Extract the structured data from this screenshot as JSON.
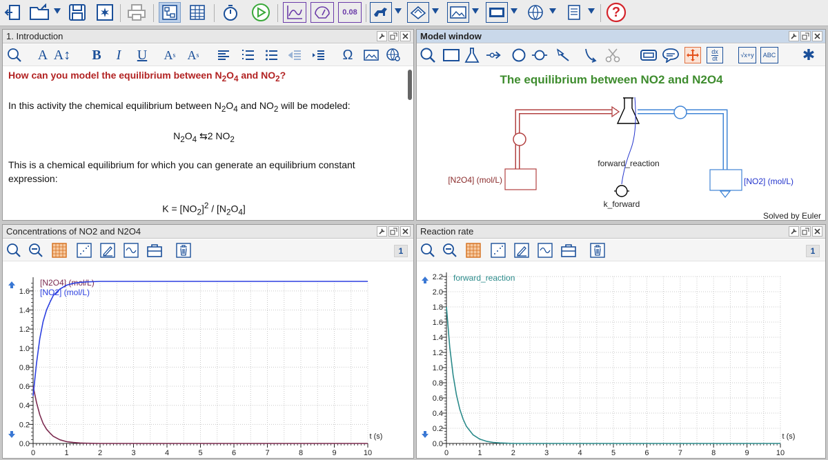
{
  "toolbar": {
    "result_label": "0.08",
    "help_label": "?"
  },
  "intro_panel": {
    "title": "1. Introduction",
    "toolbar_labels": {
      "font_a": "A",
      "bold": "B",
      "italic": "I",
      "underline": "U",
      "omega": "Ω"
    },
    "question_pre": "How can you model the equilibrium between N",
    "q_sub1": "2",
    "q_mid1": "O",
    "q_sub2": "4",
    "q_mid2": " and NO",
    "q_sub3": "2",
    "q_post": "?",
    "para1_pre": "In this activity the chemical equilibrium between N",
    "p1_sub1": "2",
    "p1_mid1": "O",
    "p1_sub2": "4",
    "p1_mid2": " and NO",
    "p1_sub3": "2",
    "p1_post": " will be modeled:",
    "eq_left": "N",
    "eq_sub1": "2",
    "eq_o": "O",
    "eq_sub2": "4",
    "eq_arrow": " ⇆",
    "eq_right": "2 NO",
    "eq_sub3": "2",
    "para2": "This is a chemical equilibrium for which you can generate an equilibrium constant expression:",
    "k_pre": "K = [NO",
    "k_sub1": "2",
    "k_mid": "]",
    "k_sup": "2",
    "k_mid2": " / [N",
    "k_sub2": "2",
    "k_o": "O",
    "k_sub3": "4",
    "k_post": "]"
  },
  "model_panel": {
    "title": "Model window",
    "heading": "The equilibrium between NO2 and N2O4",
    "flow_label": "forward_reaction",
    "stock_left": "[N2O4] (mol/L)",
    "stock_right": "[NO2] (mol/L)",
    "constant_label": "k_forward",
    "solver": "Solved by Euler",
    "tool_dxdt_top": "dx",
    "tool_dxdt_bottom": "dt",
    "tool_sqrt": "√x+y",
    "tool_abc": "ABC"
  },
  "graph1_panel": {
    "title": "Concentrations of NO2 and N2O4",
    "badge": "1"
  },
  "graph2_panel": {
    "title": "Reaction rate",
    "badge": "1"
  },
  "chart_data": [
    {
      "type": "line",
      "title": "Concentrations of NO2 and N2O4",
      "xlabel": "t (s)",
      "ylabel": "",
      "xlim": [
        0,
        10
      ],
      "ylim": [
        0,
        1.7
      ],
      "x_ticks": [
        0,
        1,
        2,
        3,
        4,
        5,
        6,
        7,
        8,
        9,
        10
      ],
      "y_ticks": [
        0.0,
        0.2,
        0.4,
        0.6,
        0.8,
        1.0,
        1.2,
        1.4,
        1.6
      ],
      "y_tick_labels": [
        "0.0",
        "0.2",
        "0.4",
        "0.6",
        "0.8",
        "1.0",
        "1.2",
        "1.4",
        "1.6"
      ],
      "grid": true,
      "legend_position": "top-left",
      "series": [
        {
          "name": "[N2O4] (mol/L)",
          "color": "#7b2a4f",
          "x": [
            0,
            0.1,
            0.2,
            0.3,
            0.4,
            0.5,
            0.6,
            0.8,
            1.0,
            1.2,
            1.4,
            1.6,
            2.0,
            3.0,
            10.0
          ],
          "y": [
            0.6,
            0.43,
            0.3,
            0.21,
            0.15,
            0.11,
            0.075,
            0.038,
            0.019,
            0.01,
            0.005,
            0.002,
            0.0,
            0.0,
            0.0
          ]
        },
        {
          "name": "[NO2] (mol/L)",
          "color": "#2b3fe0",
          "x": [
            0,
            0.1,
            0.2,
            0.3,
            0.4,
            0.5,
            0.6,
            0.8,
            1.0,
            1.2,
            1.4,
            1.6,
            2.0,
            3.0,
            10.0
          ],
          "y": [
            0.5,
            0.84,
            1.1,
            1.28,
            1.4,
            1.48,
            1.55,
            1.62,
            1.66,
            1.68,
            1.69,
            1.695,
            1.7,
            1.7,
            1.7
          ]
        }
      ]
    },
    {
      "type": "line",
      "title": "Reaction rate",
      "xlabel": "t (s)",
      "ylabel": "",
      "xlim": [
        0,
        10
      ],
      "ylim": [
        0,
        2.2
      ],
      "x_ticks": [
        0,
        1,
        2,
        3,
        4,
        5,
        6,
        7,
        8,
        9,
        10
      ],
      "y_ticks": [
        0.0,
        0.2,
        0.4,
        0.6,
        0.8,
        1.0,
        1.2,
        1.4,
        1.6,
        1.8,
        2.0,
        2.2
      ],
      "y_tick_labels": [
        "0.0",
        "0.2",
        "0.4",
        "0.6",
        "0.8",
        "1.0",
        "1.2",
        "1.4",
        "1.6",
        "1.8",
        "2.0",
        "2.2"
      ],
      "grid": true,
      "legend_position": "top-left",
      "series": [
        {
          "name": "forward_reaction",
          "color": "#2a8a8a",
          "x": [
            0,
            0.1,
            0.2,
            0.3,
            0.4,
            0.5,
            0.6,
            0.8,
            1.0,
            1.2,
            1.4,
            1.6,
            2.0,
            3.0,
            10.0
          ],
          "y": [
            1.8,
            1.27,
            0.9,
            0.64,
            0.45,
            0.32,
            0.225,
            0.113,
            0.056,
            0.028,
            0.014,
            0.007,
            0.0,
            0.0,
            0.0
          ]
        }
      ]
    }
  ]
}
